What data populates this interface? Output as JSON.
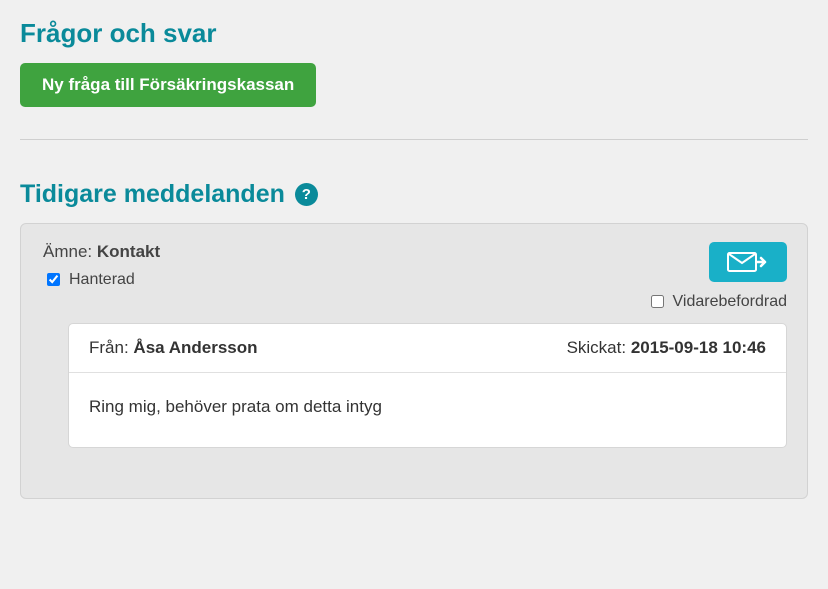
{
  "header": {
    "title": "Frågor och svar",
    "new_question_label": "Ny fråga till Försäkringskassan"
  },
  "previous": {
    "title": "Tidigare meddelanden",
    "help_glyph": "?"
  },
  "message_card": {
    "subject_label": "Ämne:",
    "subject": "Kontakt",
    "handled_label": "Hanterad",
    "handled_checked": true,
    "forwarded_label": "Vidarebefordrad",
    "forwarded_checked": false
  },
  "message": {
    "from_label": "Från:",
    "from": "Åsa Andersson",
    "sent_label": "Skickat:",
    "sent": "2015-09-18 10:46",
    "body": "Ring mig, behöver prata om detta intyg"
  },
  "colors": {
    "teal": "#0a8a9a",
    "button_teal": "#19b0c8",
    "green": "#3fa33f"
  }
}
